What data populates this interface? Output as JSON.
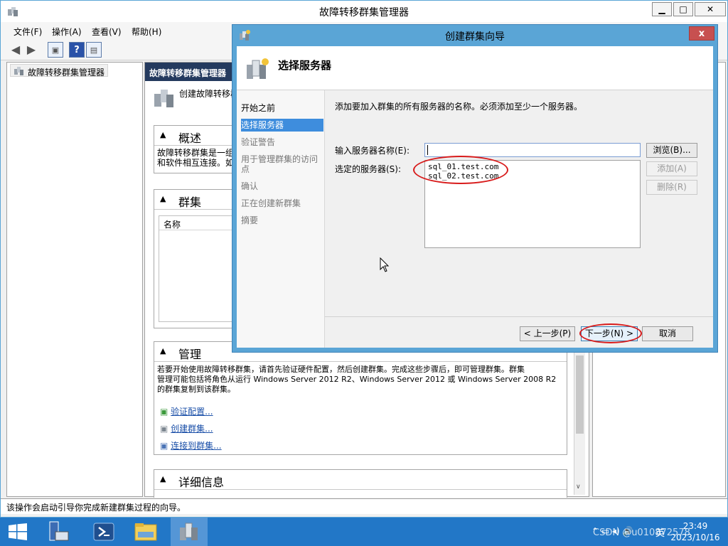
{
  "main": {
    "title": "故障转移群集管理器",
    "menu": [
      "文件(F)",
      "操作(A)",
      "查看(V)",
      "帮助(H)"
    ],
    "tree_root": "故障转移群集管理器",
    "content_header": "故障转移群集管理器",
    "create_link": "创建故障转移群",
    "overview_title": "概述",
    "overview_text_1": "故障转移群集是一组",
    "overview_text_2": "和软件相互连接。如",
    "clusters_title": "群集",
    "clusters_col": "名称",
    "manage_title": "管理",
    "manage_text_1": "若要开始使用故障转移群集，请首先验证硬件配置，然后创建群集。完成这些步骤后，即可管理群集。群集",
    "manage_text_2": "管理可能包括将角色从运行 Windows Server 2012 R2、Windows Server 2012 或 Windows Server 2008 R2",
    "manage_text_3": "的群集复制到该群集。",
    "links": [
      "验证配置...",
      "创建群集...",
      "连接到群集..."
    ],
    "details_title": "详细信息",
    "status": "该操作会启动引导你完成新建群集过程的向导。"
  },
  "wizard": {
    "title": "创建群集向导",
    "close": "x",
    "banner_title": "选择服务器",
    "steps": [
      "开始之前",
      "选择服务器",
      "验证警告",
      "用于管理群集的访问点",
      "确认",
      "正在创建新群集",
      "摘要"
    ],
    "description": "添加要加入群集的所有服务器的名称。必须添加至少一个服务器。",
    "server_name_label": "输入服务器名称(E):",
    "server_name_value": "",
    "selected_label": "选定的服务器(S):",
    "selected_servers": [
      "sql_01.test.com",
      "sql_02.test.com"
    ],
    "browse": "浏览(B)...",
    "add": "添加(A)",
    "remove": "删除(R)",
    "back": "< 上一步(P)",
    "next": "下一步(N) >",
    "cancel": "取消"
  },
  "taskbar": {
    "time": "23:49",
    "date": "2023/10/16",
    "ime": "英",
    "watermark": "CSDN @u010872578"
  },
  "colors": {
    "titlebar_active": "#5aa5d6",
    "header_navy": "#243a5e",
    "taskbar": "#2277c7",
    "selection": "#3e8ddd",
    "annotation_red": "#d81b1b"
  }
}
